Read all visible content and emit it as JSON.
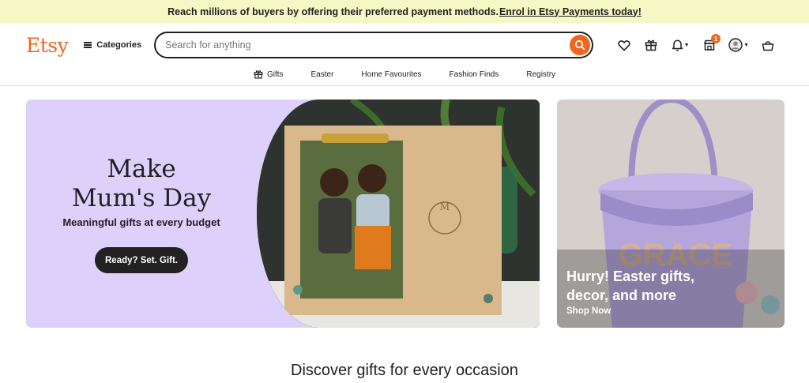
{
  "banner": {
    "text": "Reach millions of buyers by offering their preferred payment methods.",
    "link": "Enrol in Etsy Payments today!"
  },
  "header": {
    "logo": "Etsy",
    "categories_label": "Categories",
    "search_placeholder": "Search for anything",
    "cart_badge": "1"
  },
  "nav": {
    "items": [
      {
        "label": "Gifts",
        "icon": "gift-icon"
      },
      {
        "label": "Easter"
      },
      {
        "label": "Home Favourites"
      },
      {
        "label": "Fashion Finds"
      },
      {
        "label": "Registry"
      }
    ]
  },
  "hero": {
    "title_line1": "Make",
    "title_line2": "Mum's Day",
    "subtitle": "Meaningful gifts at every budget",
    "button": "Ready? Set. Gift."
  },
  "side": {
    "title_line1": "Hurry! Easter gifts,",
    "title_line2": "decor, and more",
    "link": "Shop Now"
  },
  "discover": {
    "heading": "Discover gifts for every occasion"
  },
  "colors": {
    "brand": "#f1641e",
    "banner_bg": "#f5f7c4",
    "hero_bg": "#ddd0fa"
  }
}
